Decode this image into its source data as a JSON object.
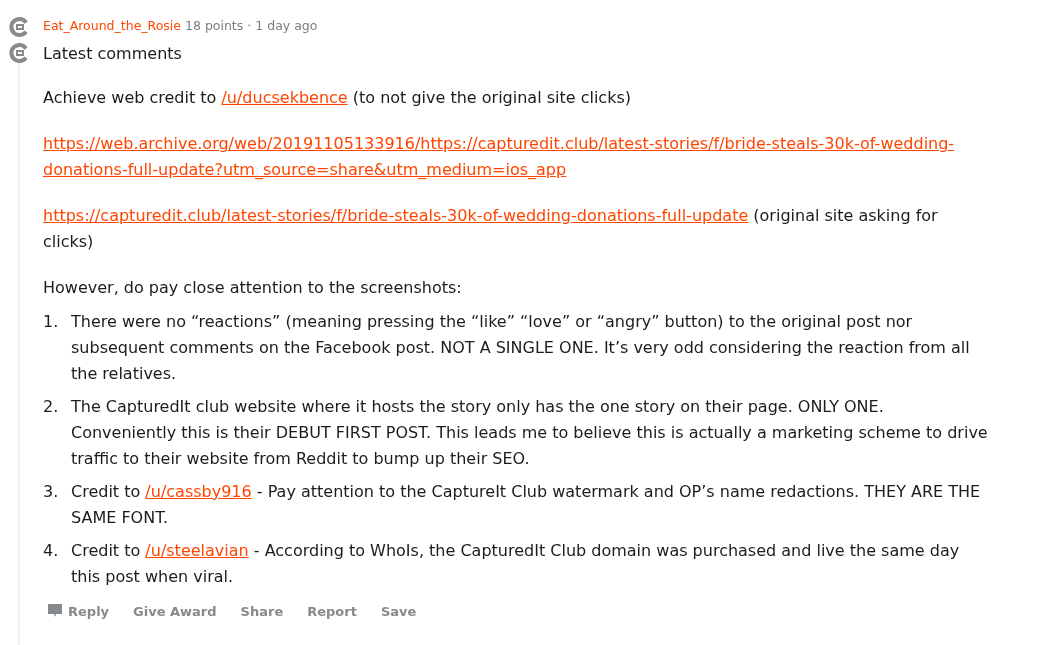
{
  "comment": {
    "author": "Eat_Around_the_Rosie",
    "points": "18 points",
    "separator": "·",
    "age": "1 day ago",
    "title": "Latest comments",
    "paragraphs": [
      {
        "kind": "text",
        "segments": [
          {
            "text": "Achieve web credit to ",
            "kind": "plain"
          },
          {
            "text": "/u/ducsekbence",
            "kind": "link"
          },
          {
            "text": " (to not give the original site clicks)",
            "kind": "plain"
          }
        ]
      },
      {
        "kind": "url",
        "segments": [
          {
            "text": "https://web.archive.org/web/20191105133916/https://capturedit.club/latest-stories/f/bride-steals-30k-of-wedding-donations-full-update?utm_source=share&utm_medium=ios_app",
            "kind": "link"
          }
        ]
      },
      {
        "kind": "text",
        "segments": [
          {
            "text": "https://capturedit.club/latest-stories/f/bride-steals-30k-of-wedding-donations-full-update",
            "kind": "link"
          },
          {
            "text": " (original site asking for clicks)",
            "kind": "plain"
          }
        ]
      },
      {
        "kind": "text",
        "segments": [
          {
            "text": "However, do pay close attention to the screenshots:",
            "kind": "plain"
          }
        ]
      }
    ],
    "list": [
      {
        "number": "1.",
        "segments": [
          {
            "text": "There were no “reactions” (meaning pressing the “like” “love” or “angry” button) to the original post nor subsequent comments on the Facebook post. NOT A SINGLE ONE. It’s very odd considering the reaction from all the relatives.",
            "kind": "plain"
          }
        ]
      },
      {
        "number": "2.",
        "segments": [
          {
            "text": "The CapturedIt club website where it hosts the story only has the one story on their page. ONLY ONE. Conveniently this is their DEBUT FIRST POST. This leads me to believe this is actually a marketing scheme to drive traffic to their website from Reddit to bump up their SEO.",
            "kind": "plain"
          }
        ]
      },
      {
        "number": "3.",
        "segments": [
          {
            "text": "Credit to ",
            "kind": "plain"
          },
          {
            "text": "/u/cassby916",
            "kind": "link"
          },
          {
            "text": " - Pay attention to the CaptureIt Club watermark and OP’s name redactions. THEY ARE THE SAME FONT.",
            "kind": "plain"
          }
        ]
      },
      {
        "number": "4.",
        "segments": [
          {
            "text": "Credit to ",
            "kind": "plain"
          },
          {
            "text": "/u/steelavian",
            "kind": "link"
          },
          {
            "text": " - According to WhoIs, the CapturedIt Club domain was purchased and live the same day this post when viral.",
            "kind": "plain"
          }
        ]
      }
    ],
    "actions": [
      {
        "label": "Reply",
        "kind": "reply"
      },
      {
        "label": "Give Award",
        "kind": "plain"
      },
      {
        "label": "Share",
        "kind": "plain"
      },
      {
        "label": "Report",
        "kind": "plain"
      },
      {
        "label": "Save",
        "kind": "plain"
      }
    ]
  }
}
